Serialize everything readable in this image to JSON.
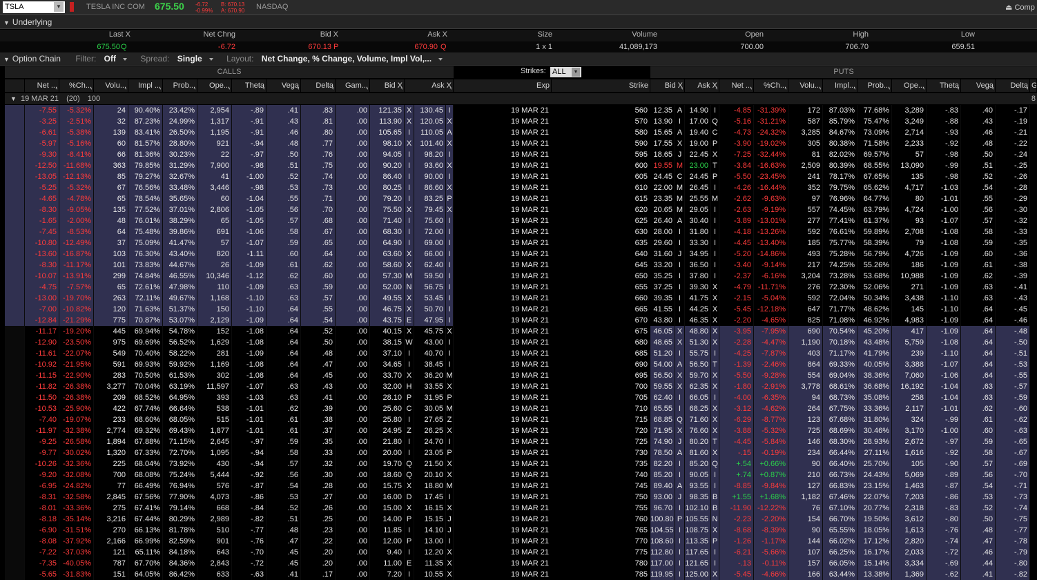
{
  "header": {
    "symbol": "TSLA",
    "company": "TESLA INC COM",
    "last": "675.50",
    "chg": "-6.72",
    "pct": "-0.99%",
    "bid": "B: 670.13",
    "ask": "A: 670.90",
    "exchange": "NASDAQ",
    "right": "Comp"
  },
  "underlying": {
    "title": "Underlying",
    "columns": [
      "Last X",
      "Net Chng",
      "Bid X",
      "Ask X",
      "Size",
      "Volume",
      "Open",
      "High",
      "Low"
    ],
    "values": [
      "675.50",
      "Q",
      "-6.72",
      "670.13",
      "P",
      "670.90",
      "Q",
      "1 x 1",
      "41,089,173",
      "700.00",
      "706.70",
      "659.51"
    ]
  },
  "chain": {
    "title": "Option Chain",
    "filter_label": "Filter:",
    "filter": "Off",
    "spread_label": "Spread:",
    "spread": "Single",
    "layout_label": "Layout:",
    "layout": "Net Change, % Change, Volume, Impl Vol,...",
    "calls": "CALLS",
    "puts": "PUTS",
    "strikes_label": "Strikes:",
    "strikes": "ALL",
    "exp_label": "19 MAR 21",
    "exp_count": "(20)",
    "exp_mult": "100",
    "exp_right": "8"
  },
  "colheads": {
    "calls": [
      "Net ...",
      "%Ch...",
      "Volu...",
      "Impl ...",
      "Prob...",
      "Ope...",
      "Theta",
      "Vega",
      "Delta",
      "Gam...",
      "Bid X",
      "Ask X"
    ],
    "mid": [
      "Exp",
      "Strike"
    ],
    "puts": [
      "Bid X",
      "Ask X",
      "Net ...",
      "%Ch...",
      "Volu...",
      "Impl...",
      "Prob...",
      "Ope...",
      "Theta",
      "Vega",
      "Delta",
      "G"
    ]
  },
  "rows": [
    [
      "-7.55",
      "-5.32%",
      "24",
      "90.40%",
      "23.42%",
      "2,954",
      "-.89",
      ".41",
      ".83",
      ".00",
      "121.35",
      "X",
      "130.45",
      "I",
      "19 MAR 21",
      "560",
      "12.35",
      "A",
      "14.90",
      "I",
      "-4.85",
      "-31.39%",
      "172",
      "87.03%",
      "77.68%",
      "3,289",
      "-.83",
      ".40",
      "-.17"
    ],
    [
      "-3.25",
      "-2.51%",
      "32",
      "87.23%",
      "24.99%",
      "1,317",
      "-.91",
      ".43",
      ".81",
      ".00",
      "113.90",
      "X",
      "120.05",
      "X",
      "19 MAR 21",
      "570",
      "13.90",
      "I",
      "17.00",
      "Q",
      "-5.16",
      "-31.21%",
      "587",
      "85.79%",
      "75.47%",
      "3,249",
      "-.88",
      ".43",
      "-.19"
    ],
    [
      "-6.61",
      "-5.38%",
      "139",
      "83.41%",
      "26.50%",
      "1,195",
      "-.91",
      ".46",
      ".80",
      ".00",
      "105.65",
      "I",
      "110.05",
      "A",
      "19 MAR 21",
      "580",
      "15.65",
      "A",
      "19.40",
      "C",
      "-4.73",
      "-24.32%",
      "3,285",
      "84.67%",
      "73.09%",
      "2,714",
      "-.93",
      ".46",
      "-.21"
    ],
    [
      "-5.97",
      "-5.16%",
      "60",
      "81.57%",
      "28.80%",
      "921",
      "-.94",
      ".48",
      ".77",
      ".00",
      "98.10",
      "X",
      "101.40",
      "X",
      "19 MAR 21",
      "590",
      "17.55",
      "X",
      "19.00",
      "P",
      "-3.90",
      "-19.02%",
      "305",
      "80.38%",
      "71.58%",
      "2,233",
      "-.92",
      ".48",
      "-.22"
    ],
    [
      "-9.30",
      "-8.41%",
      "66",
      "81.36%",
      "30.23%",
      "22",
      "-.97",
      ".50",
      ".76",
      ".00",
      "94.05",
      "I",
      "98.20",
      "I",
      "19 MAR 21",
      "595",
      "18.65",
      "J",
      "22.45",
      "X",
      "-7.25",
      "-32.44%",
      "81",
      "82.02%",
      "69.57%",
      "57",
      "-.98",
      ".50",
      "-.24"
    ],
    [
      "-12.50",
      "-11.68%",
      "363",
      "79.85%",
      "31.29%",
      "7,900",
      "-.98",
      ".51",
      ".75",
      ".00",
      "90.20",
      "I",
      "93.60",
      "X",
      "19 MAR 21",
      "600",
      "19.55",
      "M",
      "23.00",
      "T",
      "-3.84",
      "-16.63%",
      "2,509",
      "80.39%",
      "68.55%",
      "13,090",
      "-.99",
      ".51",
      "-.25"
    ],
    [
      "-13.05",
      "-12.13%",
      "85",
      "79.27%",
      "32.67%",
      "41",
      "-1.00",
      ".52",
      ".74",
      ".00",
      "86.40",
      "I",
      "90.00",
      "I",
      "19 MAR 21",
      "605",
      "24.45",
      "C",
      "24.45",
      "P",
      "-5.50",
      "-23.45%",
      "241",
      "78.17%",
      "67.65%",
      "135",
      "-.98",
      ".52",
      "-.26"
    ],
    [
      "-5.25",
      "-5.32%",
      "67",
      "76.56%",
      "33.48%",
      "3,446",
      "-.98",
      ".53",
      ".73",
      ".00",
      "80.25",
      "I",
      "86.60",
      "X",
      "19 MAR 21",
      "610",
      "22.00",
      "M",
      "26.45",
      "I",
      "-4.26",
      "-16.44%",
      "352",
      "79.75%",
      "65.62%",
      "4,717",
      "-1.03",
      ".54",
      "-.28"
    ],
    [
      "-4.65",
      "-4.78%",
      "65",
      "78.54%",
      "35.65%",
      "60",
      "-1.04",
      ".55",
      ".71",
      ".00",
      "79.20",
      "I",
      "83.25",
      "P",
      "19 MAR 21",
      "615",
      "23.35",
      "M",
      "25.55",
      "M",
      "-2.62",
      "-9.63%",
      "97",
      "76.96%",
      "64.77%",
      "80",
      "-1.01",
      ".55",
      "-.29"
    ],
    [
      "-8.30",
      "-9.05%",
      "135",
      "77.52%",
      "37.01%",
      "2,806",
      "-1.05",
      ".56",
      ".70",
      ".00",
      "75.50",
      "X",
      "79.45",
      "X",
      "19 MAR 21",
      "620",
      "20.65",
      "M",
      "29.05",
      "I",
      "-2.63",
      "-9.19%",
      "557",
      "74.45%",
      "63.79%",
      "4,724",
      "-1.00",
      ".56",
      "-.30"
    ],
    [
      "-1.65",
      "-2.00%",
      "48",
      "76.01%",
      "38.29%",
      "65",
      "-1.05",
      ".57",
      ".68",
      ".00",
      "71.40",
      "I",
      "75.60",
      "I",
      "19 MAR 21",
      "625",
      "26.40",
      "A",
      "30.40",
      "I",
      "-3.89",
      "-13.01%",
      "277",
      "77.41%",
      "61.37%",
      "93",
      "-1.07",
      ".57",
      "-.32"
    ],
    [
      "-7.45",
      "-8.53%",
      "64",
      "75.48%",
      "39.86%",
      "691",
      "-1.06",
      ".58",
      ".67",
      ".00",
      "68.30",
      "I",
      "72.00",
      "I",
      "19 MAR 21",
      "630",
      "28.00",
      "I",
      "31.80",
      "I",
      "-4.18",
      "-13.26%",
      "592",
      "76.61%",
      "59.89%",
      "2,708",
      "-1.08",
      ".58",
      "-.33"
    ],
    [
      "-10.80",
      "-12.49%",
      "37",
      "75.09%",
      "41.47%",
      "57",
      "-1.07",
      ".59",
      ".65",
      ".00",
      "64.90",
      "I",
      "69.00",
      "I",
      "19 MAR 21",
      "635",
      "29.60",
      "I",
      "33.30",
      "I",
      "-4.45",
      "-13.40%",
      "185",
      "75.77%",
      "58.39%",
      "79",
      "-1.08",
      ".59",
      "-.35"
    ],
    [
      "-13.60",
      "-16.87%",
      "103",
      "76.30%",
      "43.40%",
      "820",
      "-1.11",
      ".60",
      ".64",
      ".00",
      "63.60",
      "X",
      "66.00",
      "I",
      "19 MAR 21",
      "640",
      "31.60",
      "J",
      "34.95",
      "I",
      "-5.20",
      "-14.86%",
      "493",
      "75.28%",
      "56.79%",
      "4,726",
      "-1.09",
      ".60",
      "-.36"
    ],
    [
      "-8.30",
      "-11.17%",
      "101",
      "73.83%",
      "44.67%",
      "26",
      "-1.09",
      ".61",
      ".62",
      ".00",
      "58.60",
      "X",
      "62.40",
      "I",
      "19 MAR 21",
      "645",
      "33.20",
      "I",
      "36.50",
      "I",
      "-3.40",
      "-9.14%",
      "217",
      "74.25%",
      "55.26%",
      "186",
      "-1.09",
      ".61",
      "-.38"
    ],
    [
      "-10.07",
      "-13.91%",
      "299",
      "74.84%",
      "46.55%",
      "10,346",
      "-1.12",
      ".62",
      ".60",
      ".00",
      "57.30",
      "M",
      "59.50",
      "I",
      "19 MAR 21",
      "650",
      "35.25",
      "I",
      "37.80",
      "I",
      "-2.37",
      "-6.16%",
      "3,204",
      "73.28%",
      "53.68%",
      "10,988",
      "-1.09",
      ".62",
      "-.39"
    ],
    [
      "-4.75",
      "-7.57%",
      "65",
      "72.61%",
      "47.98%",
      "110",
      "-1.09",
      ".63",
      ".59",
      ".00",
      "52.00",
      "N",
      "56.75",
      "I",
      "19 MAR 21",
      "655",
      "37.25",
      "I",
      "39.30",
      "X",
      "-4.79",
      "-11.71%",
      "276",
      "72.30%",
      "52.06%",
      "271",
      "-1.09",
      ".63",
      "-.41"
    ],
    [
      "-13.00",
      "-19.70%",
      "263",
      "72.11%",
      "49.67%",
      "1,168",
      "-1.10",
      ".63",
      ".57",
      ".00",
      "49.55",
      "X",
      "53.45",
      "I",
      "19 MAR 21",
      "660",
      "39.35",
      "I",
      "41.75",
      "X",
      "-2.15",
      "-5.04%",
      "592",
      "72.04%",
      "50.34%",
      "3,438",
      "-1.10",
      ".63",
      "-.43"
    ],
    [
      "-7.00",
      "-10.82%",
      "120",
      "71.63%",
      "51.37%",
      "150",
      "-1.10",
      ".64",
      ".55",
      ".00",
      "46.75",
      "X",
      "50.70",
      "I",
      "19 MAR 21",
      "665",
      "41.55",
      "I",
      "44.25",
      "X",
      "-5.45",
      "-12.18%",
      "647",
      "71.77%",
      "48.62%",
      "145",
      "-1.10",
      ".64",
      "-.45"
    ],
    [
      "-12.84",
      "-21.29%",
      "775",
      "70.87%",
      "53.07%",
      "2,129",
      "-1.09",
      ".64",
      ".54",
      ".00",
      "43.75",
      "E",
      "47.95",
      "I",
      "19 MAR 21",
      "670",
      "43.80",
      "I",
      "46.35",
      "X",
      "-2.20",
      "-4.65%",
      "825",
      "71.08%",
      "46.92%",
      "4,983",
      "-1.09",
      ".64",
      "-.46"
    ],
    [
      "-11.17",
      "-19.20%",
      "445",
      "69.94%",
      "54.78%",
      "152",
      "-1.08",
      ".64",
      ".52",
      ".00",
      "40.15",
      "X",
      "45.75",
      "X",
      "19 MAR 21",
      "675",
      "46.05",
      "X",
      "48.80",
      "X",
      "-3.95",
      "-7.95%",
      "690",
      "70.54%",
      "45.20%",
      "417",
      "-1.09",
      ".64",
      "-.48"
    ],
    [
      "-12.90",
      "-23.50%",
      "975",
      "69.69%",
      "56.52%",
      "1,629",
      "-1.08",
      ".64",
      ".50",
      ".00",
      "38.15",
      "W",
      "43.00",
      "I",
      "19 MAR 21",
      "680",
      "48.65",
      "X",
      "51.30",
      "X",
      "-2.28",
      "-4.47%",
      "1,190",
      "70.18%",
      "43.48%",
      "5,759",
      "-1.08",
      ".64",
      "-.50"
    ],
    [
      "-11.61",
      "-22.07%",
      "549",
      "70.40%",
      "58.22%",
      "281",
      "-1.09",
      ".64",
      ".48",
      ".00",
      "37.10",
      "I",
      "40.70",
      "I",
      "19 MAR 21",
      "685",
      "51.20",
      "I",
      "55.75",
      "I",
      "-4.25",
      "-7.87%",
      "403",
      "71.17%",
      "41.79%",
      "239",
      "-1.10",
      ".64",
      "-.51"
    ],
    [
      "-10.92",
      "-21.95%",
      "591",
      "69.93%",
      "59.92%",
      "1,169",
      "-1.08",
      ".64",
      ".47",
      ".00",
      "34.65",
      "I",
      "38.45",
      "I",
      "19 MAR 21",
      "690",
      "54.00",
      "A",
      "56.50",
      "T",
      "-1.39",
      "-2.46%",
      "864",
      "69.33%",
      "40.05%",
      "3,388",
      "-1.07",
      ".64",
      "-.53"
    ],
    [
      "-11.15",
      "-22.90%",
      "283",
      "70.50%",
      "61.53%",
      "302",
      "-1.08",
      ".64",
      ".45",
      ".00",
      "33.70",
      "X",
      "36.20",
      "M",
      "19 MAR 21",
      "695",
      "56.50",
      "X",
      "59.70",
      "X",
      "-5.50",
      "-9.28%",
      "554",
      "69.04%",
      "38.36%",
      "7,060",
      "-1.06",
      ".64",
      "-.55"
    ],
    [
      "-11.82",
      "-26.38%",
      "3,277",
      "70.04%",
      "63.19%",
      "11,597",
      "-1.07",
      ".63",
      ".43",
      ".00",
      "32.00",
      "H",
      "33.55",
      "X",
      "19 MAR 21",
      "700",
      "59.55",
      "X",
      "62.35",
      "X",
      "-1.80",
      "-2.91%",
      "3,778",
      "68.61%",
      "36.68%",
      "16,192",
      "-1.04",
      ".63",
      "-.57"
    ],
    [
      "-11.50",
      "-26.38%",
      "209",
      "68.52%",
      "64.95%",
      "393",
      "-1.03",
      ".63",
      ".41",
      ".00",
      "28.10",
      "P",
      "31.95",
      "P",
      "19 MAR 21",
      "705",
      "62.40",
      "I",
      "66.05",
      "I",
      "-4.00",
      "-6.35%",
      "94",
      "68.73%",
      "35.08%",
      "258",
      "-1.04",
      ".63",
      "-.59"
    ],
    [
      "-10.53",
      "-25.90%",
      "422",
      "67.74%",
      "66.64%",
      "538",
      "-1.01",
      ".62",
      ".39",
      ".00",
      "25.60",
      "C",
      "30.05",
      "M",
      "19 MAR 21",
      "710",
      "65.55",
      "I",
      "68.25",
      "X",
      "-3.12",
      "-4.62%",
      "264",
      "67.75%",
      "33.36%",
      "2,117",
      "-1.01",
      ".62",
      "-.60"
    ],
    [
      "-7.40",
      "-19.07%",
      "233",
      "68.60%",
      "68.05%",
      "515",
      "-1.01",
      ".61",
      ".38",
      ".00",
      "25.80",
      "I",
      "27.65",
      "Z",
      "19 MAR 21",
      "715",
      "68.85",
      "Q",
      "71.60",
      "X",
      "-6.29",
      "-8.77%",
      "123",
      "67.68%",
      "31.80%",
      "324",
      "-.99",
      ".61",
      "-.62"
    ],
    [
      "-11.97",
      "-32.38%",
      "2,774",
      "69.32%",
      "69.43%",
      "1,877",
      "-1.01",
      ".61",
      ".37",
      ".00",
      "24.95",
      "Z",
      "26.25",
      "X",
      "19 MAR 21",
      "720",
      "71.95",
      "X",
      "76.60",
      "X",
      "-3.88",
      "-5.32%",
      "725",
      "68.69%",
      "30.46%",
      "3,170",
      "-1.00",
      ".60",
      "-.63"
    ],
    [
      "-9.25",
      "-26.58%",
      "1,894",
      "67.88%",
      "71.15%",
      "2,645",
      "-.97",
      ".59",
      ".35",
      ".00",
      "21.80",
      "I",
      "24.70",
      "I",
      "19 MAR 21",
      "725",
      "74.90",
      "J",
      "80.20",
      "T",
      "-4.45",
      "-5.84%",
      "146",
      "68.30%",
      "28.93%",
      "2,672",
      "-.97",
      ".59",
      "-.65"
    ],
    [
      "-9.77",
      "-30.02%",
      "1,320",
      "67.33%",
      "72.70%",
      "1,095",
      "-.94",
      ".58",
      ".33",
      ".00",
      "20.00",
      "I",
      "23.05",
      "P",
      "19 MAR 21",
      "730",
      "78.50",
      "A",
      "81.60",
      "X",
      "-.15",
      "-0.19%",
      "234",
      "66.44%",
      "27.11%",
      "1,616",
      "-.92",
      ".58",
      "-.67"
    ],
    [
      "-10.26",
      "-32.36%",
      "225",
      "68.04%",
      "73.92%",
      "430",
      "-.94",
      ".57",
      ".32",
      ".00",
      "19.70",
      "Q",
      "21.50",
      "X",
      "19 MAR 21",
      "735",
      "82.20",
      "I",
      "85.20",
      "Q",
      "+.54",
      "+0.66%",
      "90",
      "66.40%",
      "25.70%",
      "105",
      "-.90",
      ".57",
      "-.69"
    ],
    [
      "-9.20",
      "-32.08%",
      "700",
      "68.08%",
      "75.24%",
      "5,444",
      "-.92",
      ".56",
      ".30",
      ".00",
      "18.60",
      "Q",
      "20.10",
      "X",
      "19 MAR 21",
      "740",
      "85.20",
      "I",
      "90.05",
      "I",
      "+.74",
      "+0.87%",
      "210",
      "66.73%",
      "24.43%",
      "5,069",
      "-.89",
      ".56",
      "-.70"
    ],
    [
      "-6.95",
      "-24.82%",
      "77",
      "66.49%",
      "76.94%",
      "576",
      "-.87",
      ".54",
      ".28",
      ".00",
      "15.75",
      "X",
      "18.80",
      "M",
      "19 MAR 21",
      "745",
      "89.40",
      "A",
      "93.55",
      "I",
      "-8.85",
      "-9.84%",
      "127",
      "66.83%",
      "23.15%",
      "1,463",
      "-.87",
      ".54",
      "-.71"
    ],
    [
      "-8.31",
      "-32.58%",
      "2,845",
      "67.56%",
      "77.90%",
      "4,073",
      "-.86",
      ".53",
      ".27",
      ".00",
      "16.00",
      "D",
      "17.45",
      "I",
      "19 MAR 21",
      "750",
      "93.00",
      "J",
      "98.35",
      "B",
      "+1.55",
      "+1.68%",
      "1,182",
      "67.46%",
      "22.07%",
      "7,203",
      "-.86",
      ".53",
      "-.73"
    ],
    [
      "-8.01",
      "-33.36%",
      "275",
      "67.41%",
      "79.14%",
      "668",
      "-.84",
      ".52",
      ".26",
      ".00",
      "15.00",
      "X",
      "16.15",
      "X",
      "19 MAR 21",
      "755",
      "96.70",
      "I",
      "102.10",
      "B",
      "-11.90",
      "-12.22%",
      "76",
      "67.10%",
      "20.77%",
      "2,318",
      "-.83",
      ".52",
      "-.74"
    ],
    [
      "-8.18",
      "-35.14%",
      "3,216",
      "67.44%",
      "80.29%",
      "2,989",
      "-.82",
      ".51",
      ".25",
      ".00",
      "14.00",
      "P",
      "15.15",
      "J",
      "19 MAR 21",
      "760",
      "100.80",
      "P",
      "105.55",
      "N",
      "-2.23",
      "-2.20%",
      "154",
      "66.70%",
      "19.50%",
      "3,612",
      "-.80",
      ".50",
      "-.75"
    ],
    [
      "-6.90",
      "-31.51%",
      "270",
      "66.13%",
      "81.78%",
      "510",
      "-.77",
      ".48",
      ".23",
      ".00",
      "11.85",
      "I",
      "14.10",
      "J",
      "19 MAR 21",
      "765",
      "104.55",
      "I",
      "108.75",
      "X",
      "-8.68",
      "-8.39%",
      "90",
      "65.55%",
      "18.05%",
      "1,613",
      "-.76",
      ".48",
      "-.77"
    ],
    [
      "-8.08",
      "-37.92%",
      "2,166",
      "66.99%",
      "82.59%",
      "901",
      "-.76",
      ".47",
      ".22",
      ".00",
      "12.00",
      "P",
      "13.00",
      "I",
      "19 MAR 21",
      "770",
      "108.60",
      "I",
      "113.35",
      "P",
      "-1.26",
      "-1.17%",
      "144",
      "66.02%",
      "17.12%",
      "2,820",
      "-.74",
      ".47",
      "-.78"
    ],
    [
      "-7.22",
      "-37.03%",
      "121",
      "65.11%",
      "84.18%",
      "643",
      "-.70",
      ".45",
      ".20",
      ".00",
      "9.40",
      "I",
      "12.20",
      "X",
      "19 MAR 21",
      "775",
      "112.80",
      "I",
      "117.65",
      "I",
      "-6.21",
      "-5.66%",
      "107",
      "66.25%",
      "16.17%",
      "2,033",
      "-.72",
      ".46",
      "-.79"
    ],
    [
      "-7.35",
      "-40.05%",
      "787",
      "67.70%",
      "84.36%",
      "2,843",
      "-.72",
      ".45",
      ".20",
      ".00",
      "11.00",
      "E",
      "11.35",
      "X",
      "19 MAR 21",
      "780",
      "117.00",
      "I",
      "121.65",
      "I",
      "-.13",
      "-0.11%",
      "157",
      "66.05%",
      "15.14%",
      "3,334",
      "-.69",
      ".44",
      "-.80"
    ],
    [
      "-5.65",
      "-31.83%",
      "151",
      "64.05%",
      "86.42%",
      "633",
      "-.63",
      ".41",
      ".17",
      ".00",
      "7.20",
      "I",
      "10.55",
      "X",
      "19 MAR 21",
      "785",
      "119.95",
      "I",
      "125.00",
      "X",
      "-5.45",
      "-4.66%",
      "166",
      "63.44%",
      "13.38%",
      "1,369",
      "-.62",
      ".41",
      "-.82"
    ]
  ],
  "colors": {
    "itm": "#303050",
    "neg": "#ff3b3b",
    "pos": "#2bd24a"
  }
}
